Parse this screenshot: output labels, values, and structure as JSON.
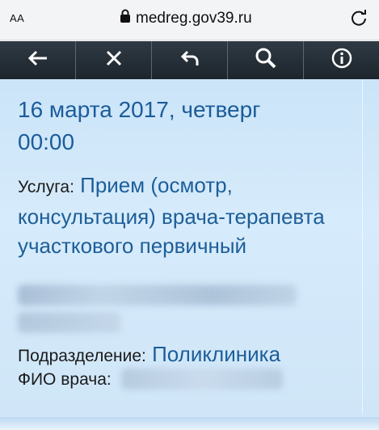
{
  "browser": {
    "text_size_label": "AA",
    "url": "medreg.gov39.ru"
  },
  "icons": {
    "lock": "lock-icon",
    "reload": "reload-icon",
    "back": "arrow-left-icon",
    "close": "close-icon",
    "undo": "undo-icon",
    "search": "search-icon",
    "info": "info-icon"
  },
  "appointment": {
    "date": "16 марта 2017, четверг",
    "time": "00:00",
    "service_label": "Услуга:",
    "service_value": "Прием (осмотр, консультация) врача-терапевта участкового первичный",
    "department_label": "Подразделение:",
    "department_value": "Поликлиника",
    "doctor_label": "ФИО врача:"
  },
  "colors": {
    "toolbar": "#1d252c",
    "content_bg": "#cfe6f8",
    "accent_text": "#1d5e99"
  }
}
